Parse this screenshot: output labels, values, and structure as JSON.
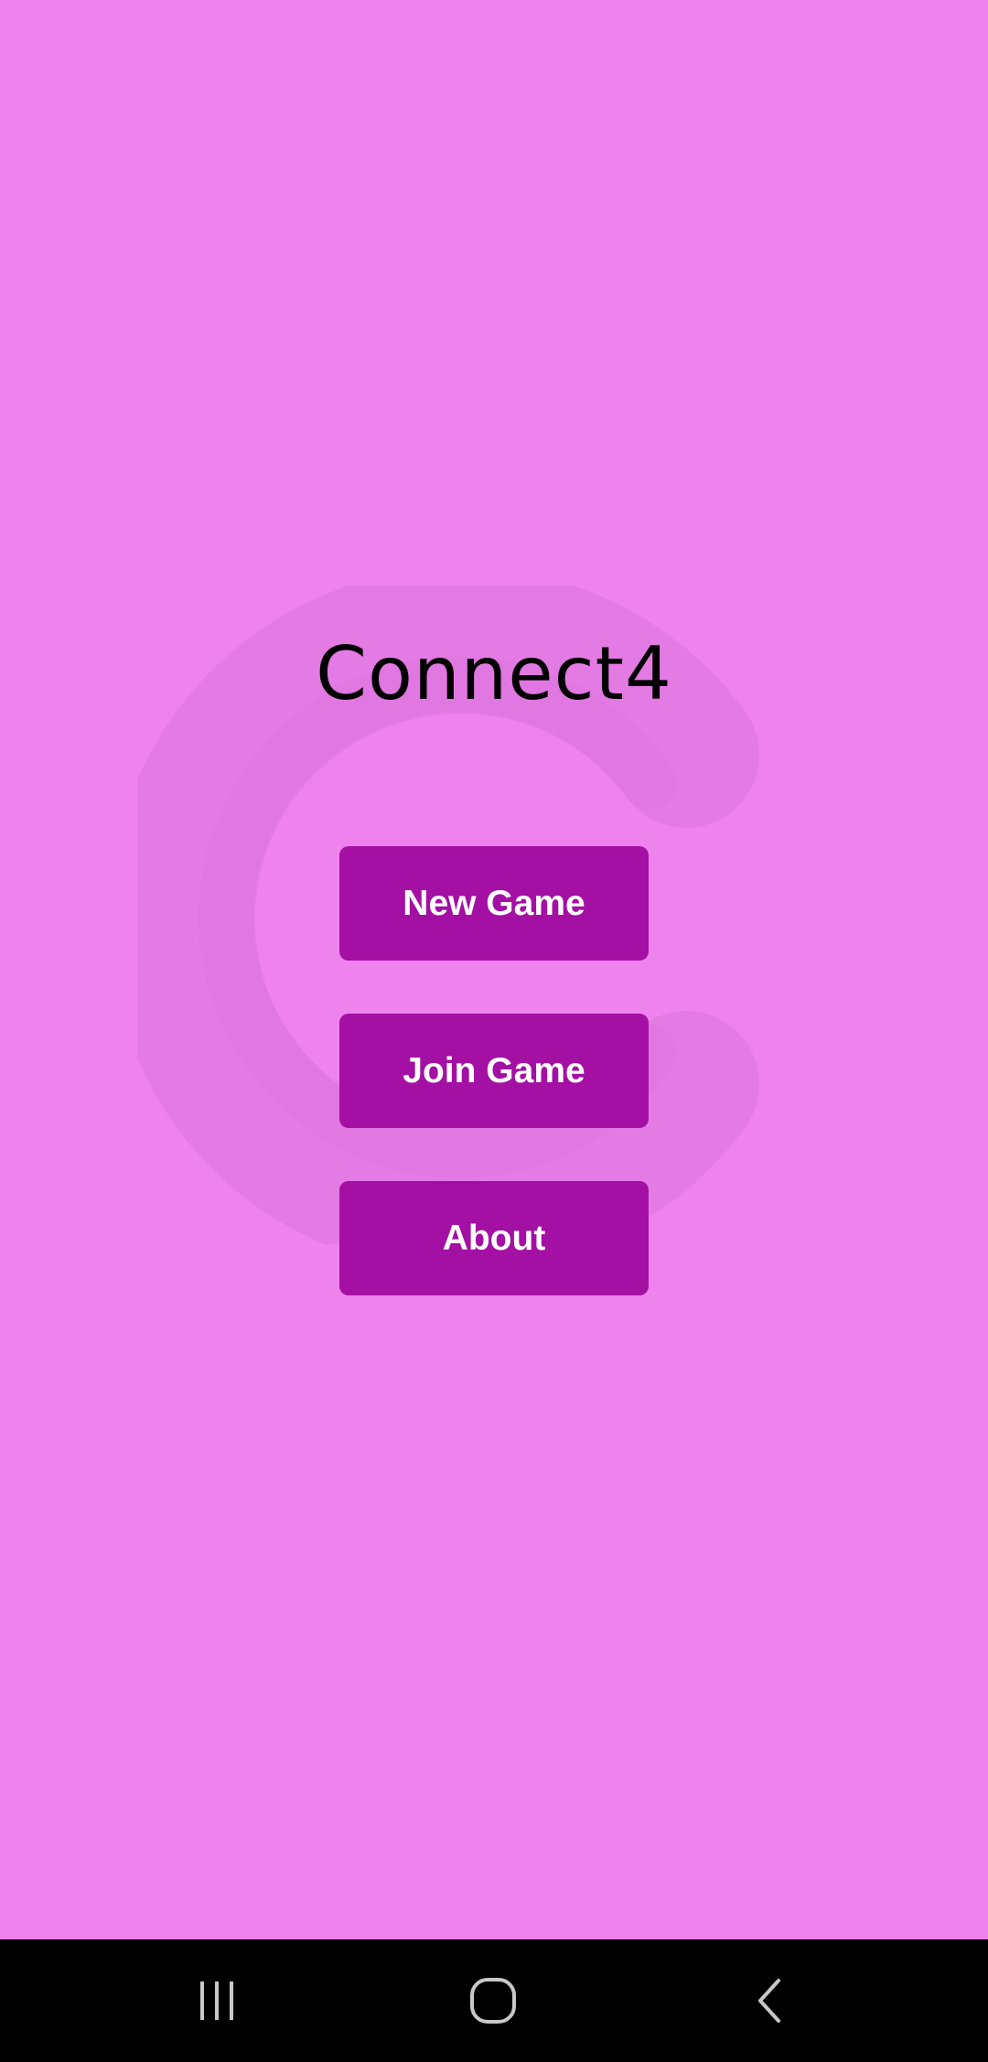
{
  "app": {
    "title": "Connect4"
  },
  "menu": {
    "new_game_label": "New Game",
    "join_game_label": "Join Game",
    "about_label": "About"
  },
  "colors": {
    "background": "#ee83ee",
    "button": "#a40fa4",
    "button_text": "#ffffff",
    "title_text": "#000000",
    "navbar": "#000000",
    "navbar_icon": "#c8c8c8"
  },
  "navbar": {
    "icons": [
      "recents-icon",
      "home-icon",
      "back-icon"
    ]
  }
}
